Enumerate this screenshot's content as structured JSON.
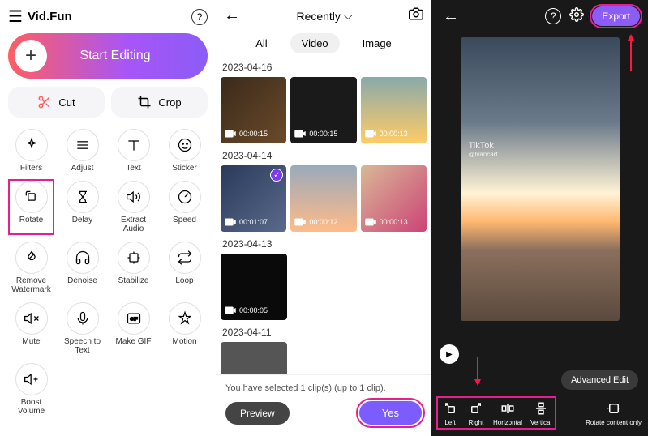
{
  "app_title": "Vid.Fun",
  "start_editing": "Start Editing",
  "cut_label": "Cut",
  "crop_label": "Crop",
  "tools": [
    {
      "label": "Filters",
      "icon": "sparkle"
    },
    {
      "label": "Adjust",
      "icon": "adjust"
    },
    {
      "label": "Text",
      "icon": "text"
    },
    {
      "label": "Sticker",
      "icon": "sticker"
    },
    {
      "label": "Rotate",
      "icon": "rotate",
      "highlighted": true
    },
    {
      "label": "Delay",
      "icon": "hourglass"
    },
    {
      "label": "Extract Audio",
      "icon": "audio"
    },
    {
      "label": "Speed",
      "icon": "speed"
    },
    {
      "label": "Remove Watermark",
      "icon": "droplet"
    },
    {
      "label": "Denoise",
      "icon": "headphones"
    },
    {
      "label": "Stabilize",
      "icon": "stabilize"
    },
    {
      "label": "Loop",
      "icon": "loop"
    },
    {
      "label": "Mute",
      "icon": "mute"
    },
    {
      "label": "Speech to Text",
      "icon": "speech"
    },
    {
      "label": "Make GIF",
      "icon": "gif"
    },
    {
      "label": "Motion",
      "icon": "motion"
    },
    {
      "label": "Boost Volume",
      "icon": "boost"
    }
  ],
  "gallery": {
    "title": "Recently",
    "tabs": {
      "all": "All",
      "video": "Video",
      "image": "Image"
    },
    "sections": [
      {
        "date": "2023-04-16",
        "thumbs": [
          {
            "dur": "00:00:15"
          },
          {
            "dur": "00:00:15"
          },
          {
            "dur": "00:00:13"
          }
        ]
      },
      {
        "date": "2023-04-14",
        "thumbs": [
          {
            "dur": "00:01:07",
            "selected": true
          },
          {
            "dur": "00:00:12"
          },
          {
            "dur": "00:00:13"
          }
        ]
      },
      {
        "date": "2023-04-13",
        "thumbs": [
          {
            "dur": "00:00:05"
          }
        ]
      },
      {
        "date": "2023-04-11",
        "thumbs": [
          {}
        ]
      }
    ],
    "selected_text": "You have selected 1 clip(s) (up to 1 clip).",
    "preview_btn": "Preview",
    "yes_btn": "Yes"
  },
  "editor": {
    "export": "Export",
    "tiktok": "TikTok",
    "tiktok_user": "@lvancart",
    "advanced_edit": "Advanced Edit",
    "rotate_opts": [
      {
        "label": "Left"
      },
      {
        "label": "Right"
      },
      {
        "label": "Horizontal"
      },
      {
        "label": "Vertical"
      }
    ],
    "rotate_only": "Rotate content only"
  }
}
